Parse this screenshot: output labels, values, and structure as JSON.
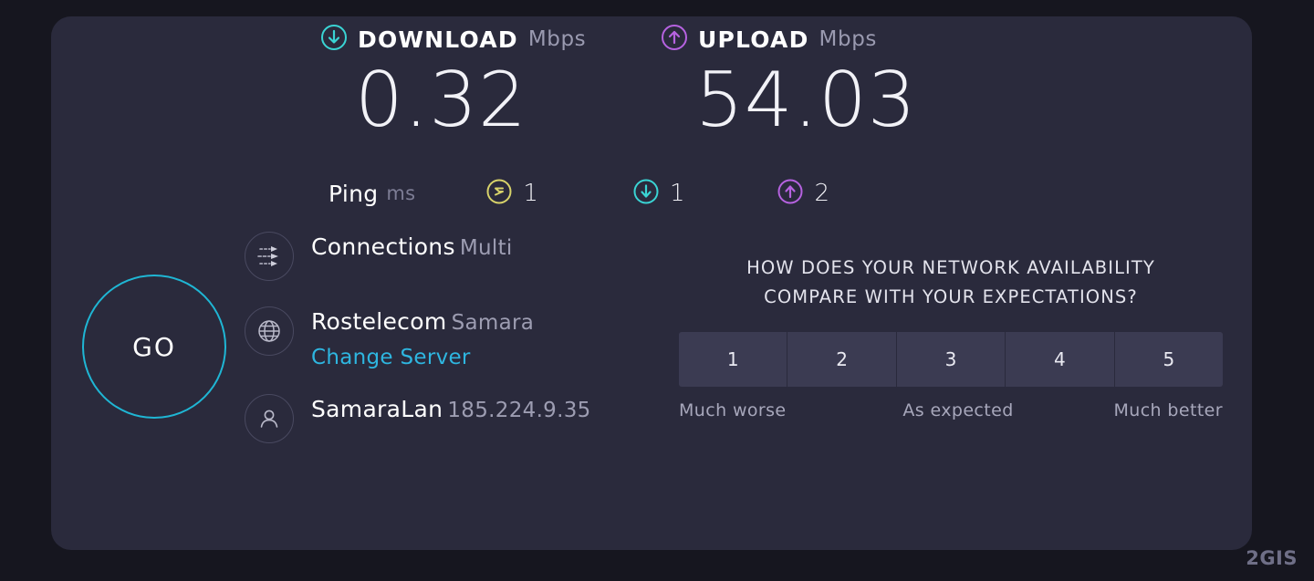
{
  "page": {
    "background_color": "#16161f",
    "card_color": "#2a2a3c",
    "watermark": "2GIS"
  },
  "results": {
    "download": {
      "label": "DOWNLOAD",
      "unit": "Mbps",
      "value": "0.32",
      "icon": "download-arrow-circle-icon",
      "color": "#3ad4d4"
    },
    "upload": {
      "label": "UPLOAD",
      "unit": "Mbps",
      "value": "54.03",
      "icon": "upload-arrow-circle-icon",
      "color": "#b662e0"
    },
    "ping": {
      "label": "Ping",
      "unit": "ms",
      "idle": {
        "value": "1",
        "icon": "idle-latency-circle-icon",
        "color": "#d8d36a"
      },
      "download": {
        "value": "1",
        "icon": "download-arrow-circle-icon",
        "color": "#3ad4d4"
      },
      "upload": {
        "value": "2",
        "icon": "upload-arrow-circle-icon",
        "color": "#b662e0"
      }
    }
  },
  "go_button": {
    "label": "GO",
    "color": "#1fb6d4"
  },
  "info": {
    "connections": {
      "icon": "multi-connection-arrows-icon",
      "title": "Connections",
      "subtitle": "Multi"
    },
    "server": {
      "icon": "globe-icon",
      "title": "Rostelecom",
      "subtitle": "Samara",
      "link": "Change Server",
      "link_color": "#2eb6e0"
    },
    "client": {
      "icon": "user-avatar-icon",
      "title": "SamaraLan",
      "subtitle": "185.224.9.35"
    }
  },
  "survey": {
    "question_line1": "HOW DOES YOUR NETWORK AVAILABILITY",
    "question_line2": "COMPARE WITH YOUR EXPECTATIONS?",
    "options": [
      "1",
      "2",
      "3",
      "4",
      "5"
    ],
    "scale_labels": [
      "Much worse",
      "As expected",
      "Much better"
    ]
  }
}
